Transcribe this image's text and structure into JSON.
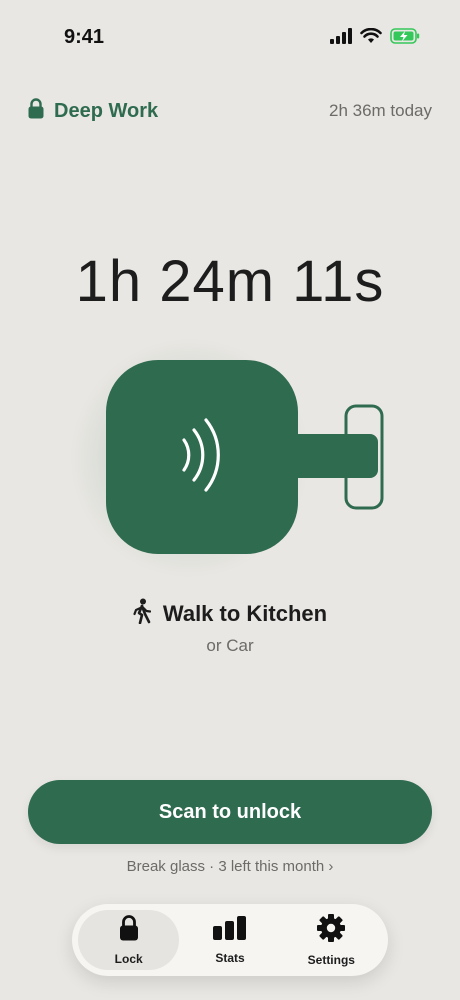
{
  "status_bar": {
    "time": "9:41",
    "icons": [
      "signal-icon",
      "wifi-icon",
      "battery-charging-icon"
    ],
    "battery_color": "#34c759"
  },
  "header": {
    "mode_icon": "lock-icon",
    "mode_label": "Deep Work",
    "today_total": "2h 36m today"
  },
  "timer": {
    "elapsed": "1h 24m 11s"
  },
  "device": {
    "icon": "nfc-tag-icon",
    "color": "#2f6b4f"
  },
  "location": {
    "icon": "walking-icon",
    "label": "Walk to Kitchen",
    "alternative": "or Car"
  },
  "actions": {
    "scan_label": "Scan to unlock",
    "break_glass": "Break glass · 3 left this month ›"
  },
  "tabs": [
    {
      "label": "Lock",
      "icon": "lock-icon",
      "active": true
    },
    {
      "label": "Stats",
      "icon": "bar-chart-icon",
      "active": false
    },
    {
      "label": "Settings",
      "icon": "gear-icon",
      "active": false
    }
  ],
  "colors": {
    "accent": "#2f6b4f",
    "background": "#e9e7e3",
    "muted_text": "#6d6b68"
  }
}
